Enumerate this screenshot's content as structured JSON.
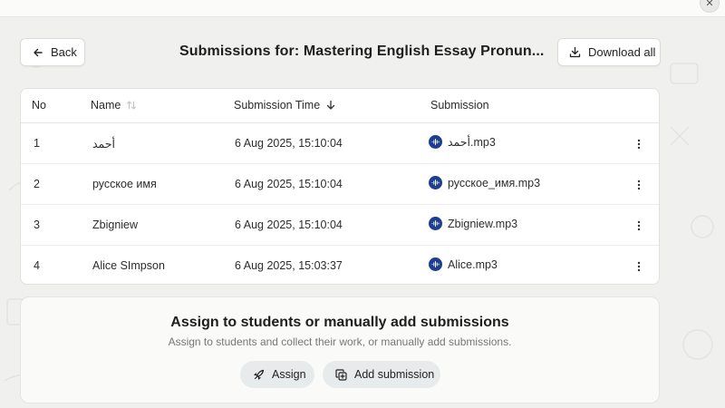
{
  "header": {
    "back_label": "Back",
    "title": "Submissions for: Mastering English Essay Pronun...",
    "download_label": "Download all"
  },
  "table": {
    "columns": [
      "No",
      "Name",
      "Submission Time",
      "Submission"
    ],
    "rows": [
      {
        "no": "1",
        "name": "أحمد",
        "time": "6 Aug 2025, 15:10:04",
        "file": "أحمد.mp3"
      },
      {
        "no": "2",
        "name": "русское имя",
        "time": "6 Aug 2025, 15:10:04",
        "file": "русское_имя.mp3"
      },
      {
        "no": "3",
        "name": "Zbigniew",
        "time": "6 Aug 2025, 15:10:04",
        "file": "Zbigniew.mp3"
      },
      {
        "no": "4",
        "name": "Alice SImpson",
        "time": "6 Aug 2025, 15:03:37",
        "file": "Alice.mp3"
      }
    ]
  },
  "assign_panel": {
    "title": "Assign to students or manually add submissions",
    "subtitle": "Assign to students and collect their work, or manually add submissions.",
    "assign_label": "Assign",
    "add_label": "Add submission"
  },
  "icons": {
    "back": "arrow-left-icon",
    "download": "download-icon",
    "sort_name": "sort-arrows-icon",
    "sort_time": "arrow-down-icon",
    "file": "audio-file-icon",
    "row_menu": "more-vertical-icon",
    "assign": "rocket-icon",
    "add": "copy-plus-icon",
    "close": "close-icon"
  },
  "colors": {
    "audio_icon": "#1e3f8f",
    "background": "#f0f0ee",
    "pill": "#e8ebec"
  }
}
